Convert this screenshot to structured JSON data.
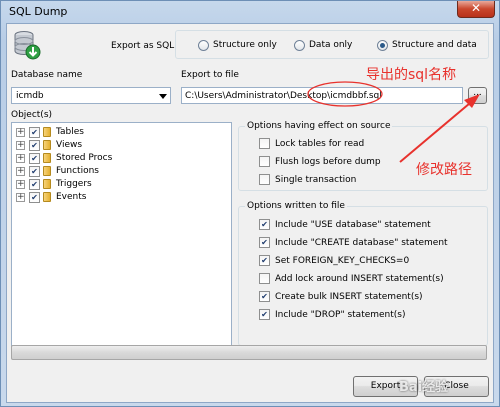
{
  "window": {
    "title": "SQL Dump",
    "close_glyph": "✕"
  },
  "export_as": {
    "label": "Export as SQL",
    "options": [
      {
        "label": "Structure only",
        "selected": false
      },
      {
        "label": "Data only",
        "selected": false
      },
      {
        "label": "Structure and data",
        "selected": true
      }
    ]
  },
  "database": {
    "label": "Database name",
    "value": "icmdb"
  },
  "export_file": {
    "label": "Export to file",
    "value": "C:\\Users\\Administrator\\Desktop\\icmdbbf.sql",
    "browse_label": "..."
  },
  "objects": {
    "label": "Object(s)",
    "items": [
      {
        "label": "Tables",
        "checked": true
      },
      {
        "label": "Views",
        "checked": true
      },
      {
        "label": "Stored Procs",
        "checked": true
      },
      {
        "label": "Functions",
        "checked": true
      },
      {
        "label": "Triggers",
        "checked": true
      },
      {
        "label": "Events",
        "checked": true
      }
    ]
  },
  "source_options": {
    "title": "Options having effect on source",
    "items": [
      {
        "label": "Lock tables for read",
        "checked": false
      },
      {
        "label": "Flush logs before dump",
        "checked": false
      },
      {
        "label": "Single transaction",
        "checked": false
      }
    ]
  },
  "file_options": {
    "title": "Options written to file",
    "items": [
      {
        "label": "Include \"USE database\" statement",
        "checked": true
      },
      {
        "label": "Include \"CREATE database\" statement",
        "checked": true
      },
      {
        "label": "Set FOREIGN_KEY_CHECKS=0",
        "checked": true
      },
      {
        "label": "Add lock around INSERT statement(s)",
        "checked": false
      },
      {
        "label": "Create bulk INSERT statement(s)",
        "checked": true
      },
      {
        "label": "Include \"DROP\" statement(s)",
        "checked": true
      }
    ]
  },
  "progress": {
    "value": 0
  },
  "buttons": {
    "export": "Export",
    "close": "Close"
  },
  "annotations": {
    "sql_name": "导出的sql名称",
    "change_path": "修改路径",
    "color": "#e8322d"
  },
  "watermark": "Bai经验"
}
